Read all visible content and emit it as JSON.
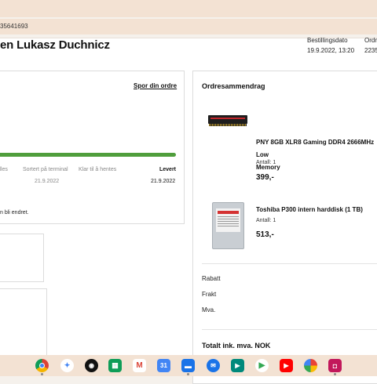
{
  "browser": {
    "url_fragment": "35641693"
  },
  "header": {
    "title": "en Lukasz Duchnicz",
    "order_date_label": "Bestillingsdato",
    "order_date_value": "19.9.2022, 13:20",
    "order_number_label": "Ordr",
    "order_number_value": "2235"
  },
  "tracking": {
    "track_link": "Spor din ordre",
    "progress_percent": 100,
    "steps": [
      {
        "label": "dles",
        "date": ""
      },
      {
        "label": "Sortert på terminal",
        "date": "21.9.2022"
      },
      {
        "label": "Klar til å hentes",
        "date": ""
      },
      {
        "label": "Levert",
        "date": "21.9.2022"
      }
    ],
    "note": "n bli endret."
  },
  "summary": {
    "title": "Ordresammendrag",
    "products": [
      {
        "name": "PNY 8GB XLR8 Gaming DDR4 2666MHz Low Memory",
        "name_line1": "PNY 8GB XLR8 Gaming DDR4 2666MHz Low",
        "name_line2": "Memory",
        "quantity": "Antall: 1",
        "price": "399,-",
        "image_icon": "ram-module-image"
      },
      {
        "name": "Toshiba P300 intern harddisk (1 TB)",
        "quantity": "Antall: 1",
        "price": "513,-",
        "image_icon": "hard-drive-image"
      }
    ],
    "discount_label": "Rabatt",
    "shipping_label": "Frakt",
    "vat_label": "Mva.",
    "total_label": "Totalt ink. mva. NOK"
  },
  "shelf": {
    "apps": [
      "chrome-icon",
      "assistant-icon",
      "podcasts-icon",
      "apps-icon",
      "gmail-icon",
      "calendar-icon",
      "files-icon",
      "messages-icon",
      "meet-icon",
      "play-store-icon",
      "youtube-icon",
      "photos-icon",
      "screencast-icon"
    ]
  },
  "colors": {
    "progress": "#4f9e3c",
    "shelf": "#f3e2d3"
  }
}
